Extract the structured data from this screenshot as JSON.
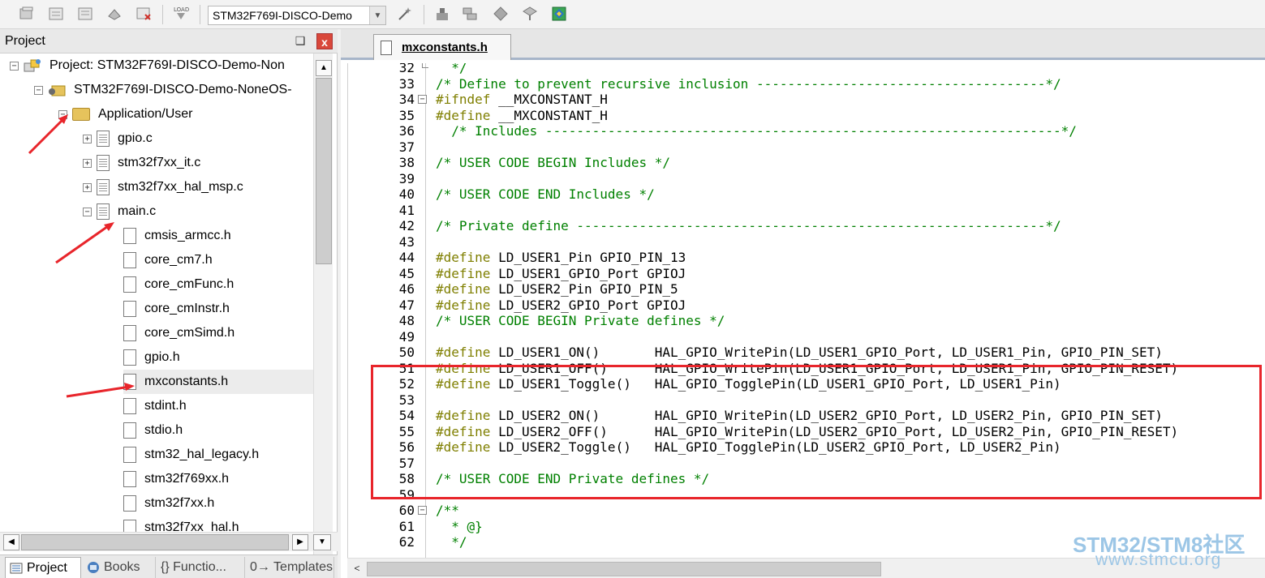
{
  "toolbar": {
    "target": "STM32F769I-DISCO-Demo"
  },
  "project_panel": {
    "title": "Project",
    "pin": "❑",
    "close": "x",
    "tree": [
      {
        "label": "Project: STM32F769I-DISCO-Demo-Non",
        "level": 0,
        "type": "project",
        "expander": "−"
      },
      {
        "label": "STM32F769I-DISCO-Demo-NoneOS-",
        "level": 1,
        "type": "target",
        "expander": "−"
      },
      {
        "label": "Application/User",
        "level": 2,
        "type": "folder",
        "expander": "−"
      },
      {
        "label": "gpio.c",
        "level": 3,
        "type": "file-c",
        "expander": "+"
      },
      {
        "label": "stm32f7xx_it.c",
        "level": 3,
        "type": "file-c",
        "expander": "+"
      },
      {
        "label": "stm32f7xx_hal_msp.c",
        "level": 3,
        "type": "file-c",
        "expander": "+"
      },
      {
        "label": "main.c",
        "level": 3,
        "type": "file-c",
        "expander": "−"
      },
      {
        "label": "cmsis_armcc.h",
        "level": 4,
        "type": "file-h",
        "expander": ""
      },
      {
        "label": "core_cm7.h",
        "level": 4,
        "type": "file-h",
        "expander": ""
      },
      {
        "label": "core_cmFunc.h",
        "level": 4,
        "type": "file-h",
        "expander": ""
      },
      {
        "label": "core_cmInstr.h",
        "level": 4,
        "type": "file-h",
        "expander": ""
      },
      {
        "label": "core_cmSimd.h",
        "level": 4,
        "type": "file-h",
        "expander": ""
      },
      {
        "label": "gpio.h",
        "level": 4,
        "type": "file-h",
        "expander": ""
      },
      {
        "label": "mxconstants.h",
        "level": 4,
        "type": "file-h",
        "expander": "",
        "selected": true
      },
      {
        "label": "stdint.h",
        "level": 4,
        "type": "file-h",
        "expander": ""
      },
      {
        "label": "stdio.h",
        "level": 4,
        "type": "file-h",
        "expander": ""
      },
      {
        "label": "stm32_hal_legacy.h",
        "level": 4,
        "type": "file-h",
        "expander": ""
      },
      {
        "label": "stm32f769xx.h",
        "level": 4,
        "type": "file-h",
        "expander": ""
      },
      {
        "label": "stm32f7xx.h",
        "level": 4,
        "type": "file-h",
        "expander": ""
      },
      {
        "label": "stm32f7xx_hal.h",
        "level": 4,
        "type": "file-h",
        "expander": ""
      }
    ],
    "tabs": [
      {
        "label": "Project",
        "icon": "project-icon"
      },
      {
        "label": "Books",
        "icon": "books-icon"
      },
      {
        "label": "{} Functio...",
        "icon": "functions-icon"
      },
      {
        "label": "0→ Templates",
        "icon": "templates-icon"
      }
    ]
  },
  "editor": {
    "tab_label": "mxconstants.h",
    "lines": [
      {
        "n": "32",
        "fold": "tick",
        "segs": [
          [
            "cm",
            "  */"
          ]
        ]
      },
      {
        "n": "33",
        "fold": "",
        "segs": [
          [
            "cm",
            "/* Define to prevent recursive inclusion -------------------------------------*/"
          ]
        ]
      },
      {
        "n": "34",
        "fold": "box",
        "segs": [
          [
            "kw",
            "#ifndef"
          ],
          [
            "fn",
            " __MXCONSTANT_H"
          ]
        ]
      },
      {
        "n": "35",
        "fold": "",
        "segs": [
          [
            "kw",
            "#define"
          ],
          [
            "fn",
            " __MXCONSTANT_H"
          ]
        ]
      },
      {
        "n": "36",
        "fold": "",
        "segs": [
          [
            "cm",
            "  /* Includes ------------------------------------------------------------------*/"
          ]
        ]
      },
      {
        "n": "37",
        "fold": "",
        "segs": []
      },
      {
        "n": "38",
        "fold": "",
        "segs": [
          [
            "cm",
            "/* USER CODE BEGIN Includes */"
          ]
        ]
      },
      {
        "n": "39",
        "fold": "",
        "segs": []
      },
      {
        "n": "40",
        "fold": "",
        "segs": [
          [
            "cm",
            "/* USER CODE END Includes */"
          ]
        ]
      },
      {
        "n": "41",
        "fold": "",
        "segs": []
      },
      {
        "n": "42",
        "fold": "",
        "segs": [
          [
            "cm",
            "/* Private define ------------------------------------------------------------*/"
          ]
        ]
      },
      {
        "n": "43",
        "fold": "",
        "segs": []
      },
      {
        "n": "44",
        "fold": "",
        "segs": [
          [
            "kw",
            "#define"
          ],
          [
            "fn",
            " LD_USER1_Pin GPIO_PIN_13"
          ]
        ]
      },
      {
        "n": "45",
        "fold": "",
        "segs": [
          [
            "kw",
            "#define"
          ],
          [
            "fn",
            " LD_USER1_GPIO_Port GPIOJ"
          ]
        ]
      },
      {
        "n": "46",
        "fold": "",
        "segs": [
          [
            "kw",
            "#define"
          ],
          [
            "fn",
            " LD_USER2_Pin GPIO_PIN_5"
          ]
        ]
      },
      {
        "n": "47",
        "fold": "",
        "segs": [
          [
            "kw",
            "#define"
          ],
          [
            "fn",
            " LD_USER2_GPIO_Port GPIOJ"
          ]
        ]
      },
      {
        "n": "48",
        "fold": "",
        "segs": [
          [
            "cm",
            "/* USER CODE BEGIN Private defines */"
          ]
        ]
      },
      {
        "n": "49",
        "fold": "",
        "segs": []
      },
      {
        "n": "50",
        "fold": "",
        "segs": [
          [
            "kw",
            "#define"
          ],
          [
            "fn",
            " LD_USER1_ON()       HAL_GPIO_WritePin(LD_USER1_GPIO_Port, LD_USER1_Pin, GPIO_PIN_SET)"
          ]
        ]
      },
      {
        "n": "51",
        "fold": "",
        "segs": [
          [
            "kw",
            "#define"
          ],
          [
            "fn",
            " LD_USER1_OFF()      HAL_GPIO_WritePin(LD_USER1_GPIO_Port, LD_USER1_Pin, GPIO_PIN_RESET)"
          ]
        ]
      },
      {
        "n": "52",
        "fold": "",
        "segs": [
          [
            "kw",
            "#define"
          ],
          [
            "fn",
            " LD_USER1_Toggle()   HAL_GPIO_TogglePin(LD_USER1_GPIO_Port, LD_USER1_Pin)"
          ]
        ]
      },
      {
        "n": "53",
        "fold": "",
        "segs": []
      },
      {
        "n": "54",
        "fold": "",
        "segs": [
          [
            "kw",
            "#define"
          ],
          [
            "fn",
            " LD_USER2_ON()       HAL_GPIO_WritePin(LD_USER2_GPIO_Port, LD_USER2_Pin, GPIO_PIN_SET)"
          ]
        ]
      },
      {
        "n": "55",
        "fold": "",
        "segs": [
          [
            "kw",
            "#define"
          ],
          [
            "fn",
            " LD_USER2_OFF()      HAL_GPIO_WritePin(LD_USER2_GPIO_Port, LD_USER2_Pin, GPIO_PIN_RESET)"
          ]
        ]
      },
      {
        "n": "56",
        "fold": "",
        "segs": [
          [
            "kw",
            "#define"
          ],
          [
            "fn",
            " LD_USER2_Toggle()   HAL_GPIO_TogglePin(LD_USER2_GPIO_Port, LD_USER2_Pin)"
          ]
        ]
      },
      {
        "n": "57",
        "fold": "",
        "segs": []
      },
      {
        "n": "58",
        "fold": "",
        "segs": [
          [
            "cm",
            "/* USER CODE END Private defines */"
          ]
        ]
      },
      {
        "n": "59",
        "fold": "",
        "segs": []
      },
      {
        "n": "60",
        "fold": "box",
        "segs": [
          [
            "cm",
            "/**"
          ]
        ]
      },
      {
        "n": "61",
        "fold": "",
        "segs": [
          [
            "cm",
            "  * @}"
          ]
        ]
      },
      {
        "n": "62",
        "fold": "",
        "segs": [
          [
            "cm",
            "  */"
          ]
        ]
      }
    ]
  },
  "watermark": {
    "line1": "STM32/STM8社区",
    "line2": "www.stmcu.org"
  },
  "colors": {
    "comment": "#008000",
    "preprocessor": "#7f7f00",
    "highlight_box": "#e8252b",
    "annotation_arrow": "#e8252b",
    "watermark": "#9cc6e6"
  }
}
